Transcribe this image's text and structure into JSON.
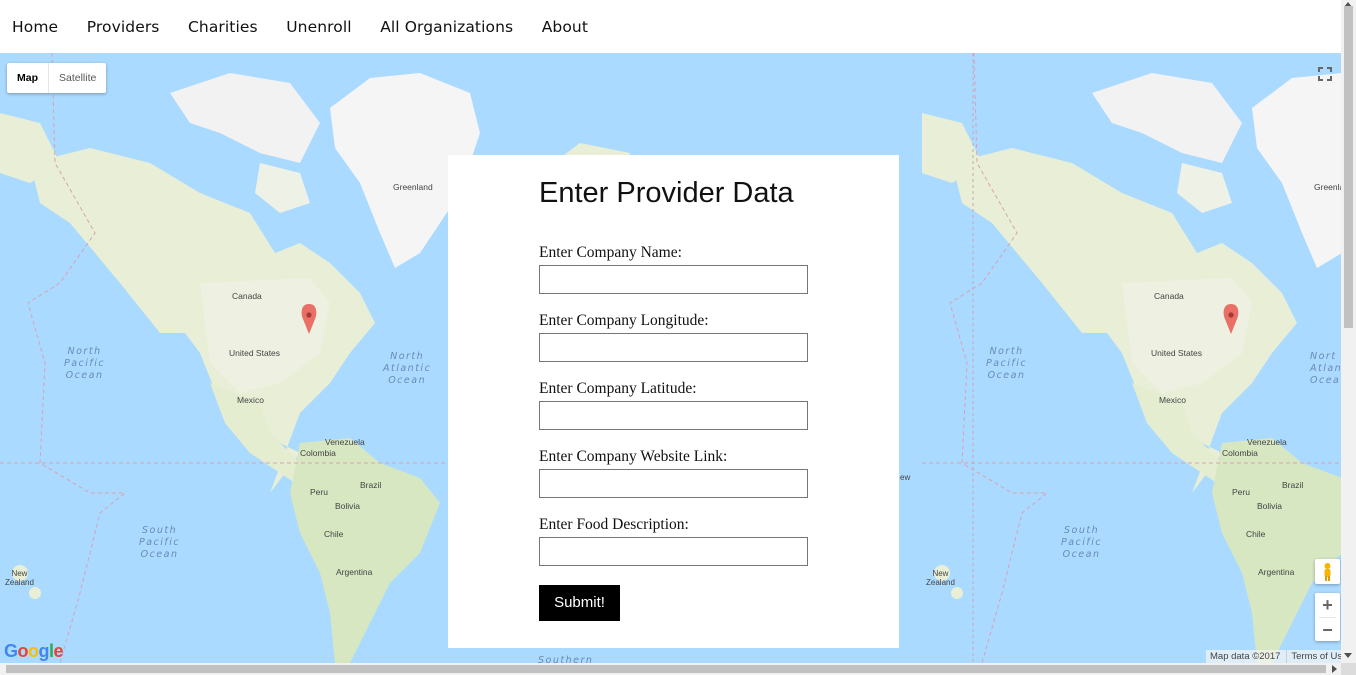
{
  "nav": {
    "items": [
      "Home",
      "Providers",
      "Charities",
      "Unenroll",
      "All Organizations",
      "About"
    ]
  },
  "map": {
    "type_control": {
      "map": "Map",
      "satellite": "Satellite"
    },
    "labels": {
      "greenland": "Greenland",
      "greenland_partial": "Greenla",
      "canada": "Canada",
      "united_states": "United States",
      "mexico": "Mexico",
      "venezuela": "Venezuela",
      "colombia": "Colombia",
      "peru": "Peru",
      "brazil": "Brazil",
      "bolivia": "Bolivia",
      "chile": "Chile",
      "argentina": "Argentina",
      "new_zealand": [
        "New",
        "Zealand"
      ],
      "nz_partial": "ew",
      "north_pacific": [
        "North",
        "Pacific",
        "Ocean"
      ],
      "north_atlantic": [
        "North",
        "Atlantic",
        "Ocean"
      ],
      "north_atlantic_partial": [
        "Nort",
        "Atlan",
        "Ocea"
      ],
      "south_pacific": [
        "South",
        "Pacific",
        "Ocean"
      ],
      "southern": "Southern"
    },
    "attribution": {
      "data": "Map data ©2017",
      "terms": "Terms of Use"
    },
    "zoom": {
      "in": "+",
      "out": "−"
    },
    "logo": [
      "G",
      "o",
      "o",
      "g",
      "l",
      "e"
    ],
    "colors": {
      "water": "#aadaff",
      "land": "#e8efd6",
      "ice": "#f5f5f5",
      "marker": "#ea4335"
    }
  },
  "form": {
    "title": "Enter Provider Data",
    "fields": [
      {
        "label": "Enter Company Name:",
        "value": ""
      },
      {
        "label": "Enter Company Longitude:",
        "value": ""
      },
      {
        "label": "Enter Company Latitude:",
        "value": ""
      },
      {
        "label": "Enter Company Website Link:",
        "value": ""
      },
      {
        "label": "Enter Food Description:",
        "value": ""
      }
    ],
    "submit_label": "Submit!"
  }
}
